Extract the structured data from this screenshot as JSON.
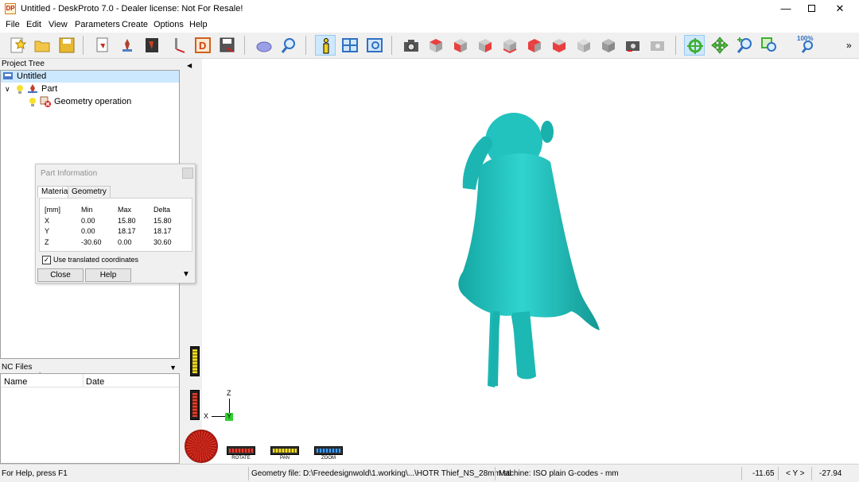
{
  "window": {
    "title": "Untitled - DeskProto 7.0 - Dealer license: Not For Resale!",
    "app_icon_text": "DP"
  },
  "menu": [
    "File",
    "Edit",
    "View",
    "Parameters",
    "Create",
    "Options",
    "Help"
  ],
  "toolbar": {
    "zoom_percent_label": "100%"
  },
  "project_tree": {
    "header": "Project Tree",
    "items": [
      {
        "label": "Untitled"
      },
      {
        "label": "Part"
      },
      {
        "label": "Geometry operation"
      }
    ]
  },
  "nc_files": {
    "header": "NC Files",
    "columns": [
      "Name",
      "Date"
    ]
  },
  "part_info": {
    "title": "Part Information",
    "tabs": [
      "Material",
      "Geometry"
    ],
    "table": {
      "headers": [
        "[mm]",
        "Min",
        "Max",
        "Delta"
      ],
      "rows": [
        [
          "X",
          "0.00",
          "15.80",
          "15.80"
        ],
        [
          "Y",
          "0.00",
          "18.17",
          "18.17"
        ],
        [
          "Z",
          "-30.60",
          "0.00",
          "30.60"
        ]
      ]
    },
    "checkbox_label": "Use translated coordinates",
    "checkbox_checked": true,
    "close_label": "Close",
    "help_label": "Help"
  },
  "axes": {
    "z": "Z",
    "x": "X",
    "y": "Y"
  },
  "camera_controls": [
    "ROTATE",
    "PAN",
    "ZOOM"
  ],
  "status": {
    "help": "For Help, press F1",
    "geometry_file": "Geometry file: D:\\Freedesignwold\\1.working\\...\\HOTR Thief_NS_28mm.stl",
    "machine": "Machine: ISO plain G-codes - mm",
    "x": "-11.65",
    "axis_label": "< Y >",
    "y": "-27.94"
  },
  "colors": {
    "model": "#1fc4c0",
    "selection": "#cce8ff",
    "viewport_bg": "#ffffff"
  }
}
